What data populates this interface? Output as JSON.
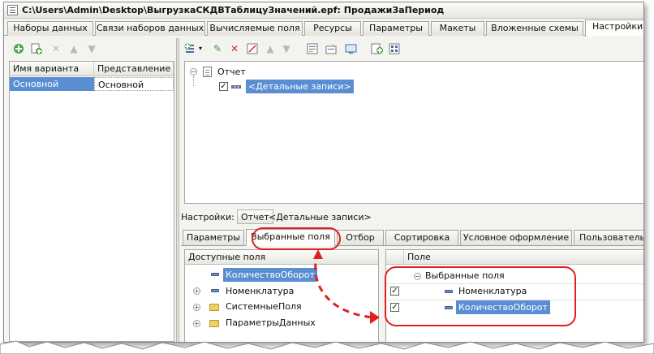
{
  "window": {
    "title": "C:\\Users\\Admin\\Desktop\\ВыгрузкаСКДВТаблицуЗначений.epf: ПродажиЗаПериод"
  },
  "tabs": [
    {
      "label": "Наборы данных"
    },
    {
      "label": "Связи наборов данных"
    },
    {
      "label": "Вычисляемые поля"
    },
    {
      "label": "Ресурсы"
    },
    {
      "label": "Параметры"
    },
    {
      "label": "Макеты"
    },
    {
      "label": "Вложенные схемы"
    },
    {
      "label": "Настройки"
    }
  ],
  "variants": {
    "columns": [
      "Имя варианта",
      "Представление"
    ],
    "rows": [
      {
        "name": "Основной",
        "presentation": "Основной"
      }
    ]
  },
  "structure": {
    "root": "Отчет",
    "child": "<Детальные записи>"
  },
  "settings_bar": {
    "label": "Настройки:",
    "button": "Отчет",
    "value": "<Детальные записи>"
  },
  "sub_tabs": [
    {
      "label": "Параметры"
    },
    {
      "label": "Выбранные поля"
    },
    {
      "label": "Отбор"
    },
    {
      "label": "Сортировка"
    },
    {
      "label": "Условное оформление"
    },
    {
      "label": "Пользовательские"
    }
  ],
  "available_fields": {
    "header": "Доступные поля",
    "items": [
      {
        "label": "КоличествоОборот",
        "icon": "field-icon"
      },
      {
        "label": "Номенклатура",
        "icon": "field-icon"
      },
      {
        "label": "СистемныеПоля",
        "icon": "folder-icon"
      },
      {
        "label": "ПараметрыДанных",
        "icon": "folder-icon"
      }
    ]
  },
  "selected_fields": {
    "header": "Поле",
    "group": "Выбранные поля",
    "items": [
      {
        "label": "Номенклатура",
        "checked": true
      },
      {
        "label": "КоличествоОборот",
        "checked": true
      }
    ]
  },
  "colors": {
    "selection": "#5a8ed3",
    "annotation": "#e02020"
  }
}
